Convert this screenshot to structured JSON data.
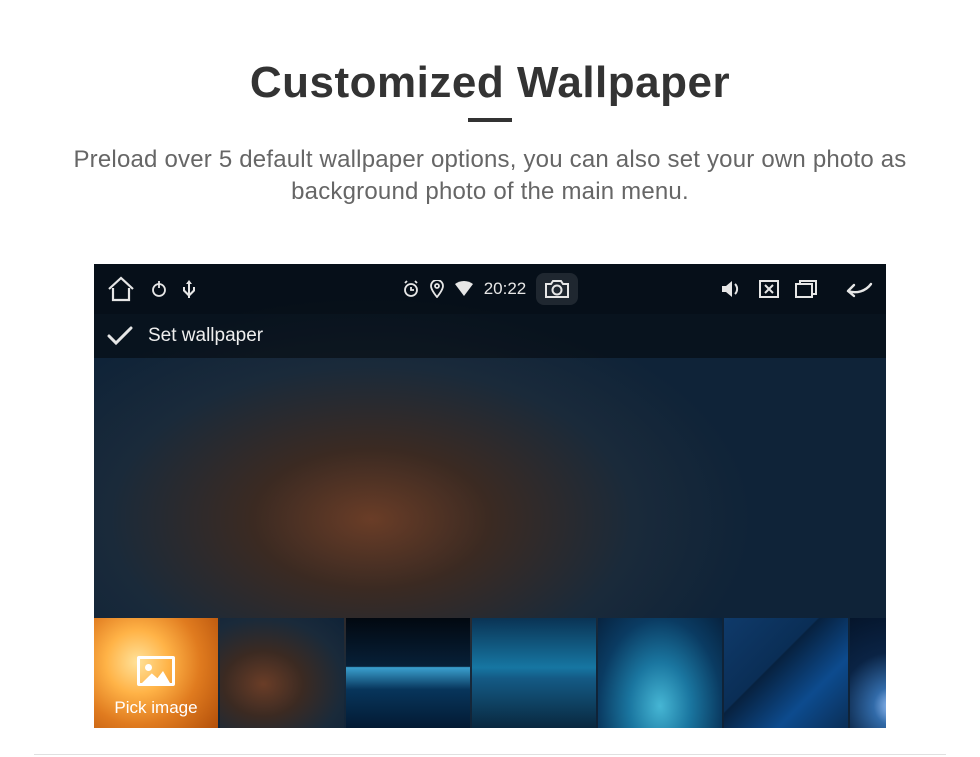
{
  "page": {
    "title": "Customized Wallpaper",
    "subtitle": "Preload over 5 default wallpaper options, you can also set your own photo as background photo of the main menu."
  },
  "statusbar": {
    "time": "20:22"
  },
  "screen": {
    "set_wallpaper_label": "Set wallpaper",
    "pick_image_label": "Pick image"
  }
}
